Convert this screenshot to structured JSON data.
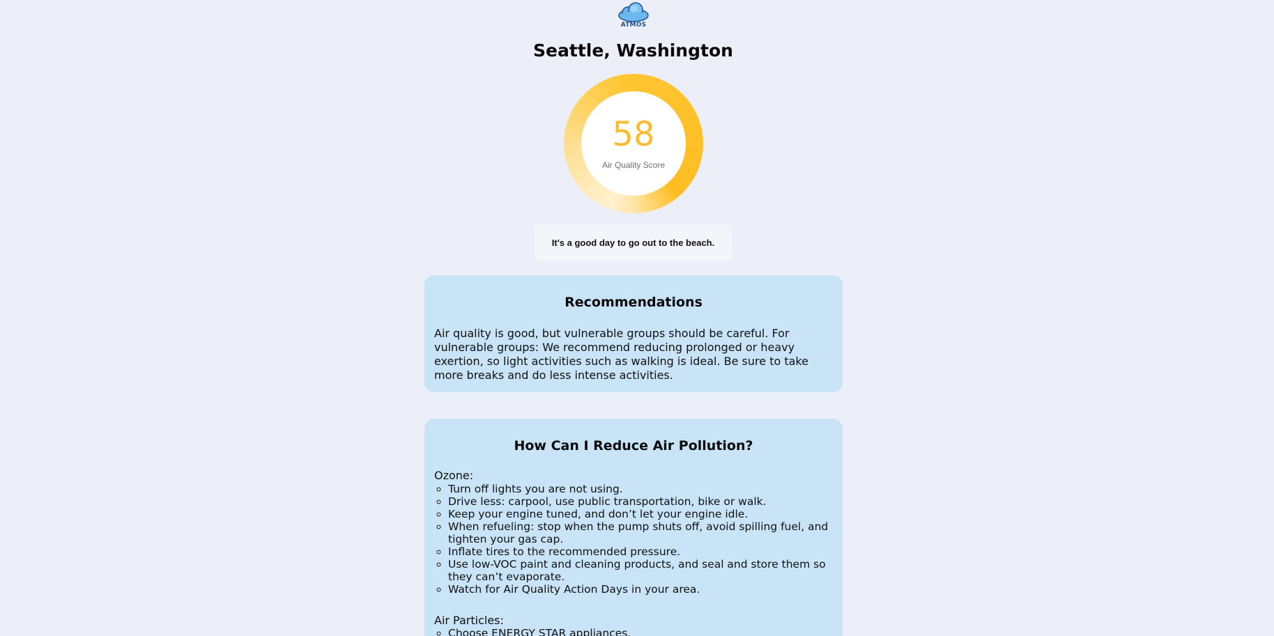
{
  "logo": {
    "text": "ATMOS",
    "icon": "cloud-icon"
  },
  "location": {
    "city": "Seattle, Washington"
  },
  "air_quality": {
    "score": "58",
    "label": "Air Quality Score",
    "color": "#fbbd2e",
    "message": "It's a good day to go out to the beach."
  },
  "recommendations": {
    "title": "Recommendations",
    "text": "Air quality is good, but vulnerable groups should be careful. For vulnerable groups: We recommend reducing prolonged or heavy exertion, so light activities such as walking is ideal. Be sure to take more breaks and do less intense activities."
  },
  "reduce": {
    "title": "How Can I Reduce Air Pollution?",
    "sections": [
      {
        "heading": "Ozone:",
        "items": [
          "Turn off lights you are not using.",
          "Drive less: carpool, use public transportation, bike or walk.",
          "Keep your engine tuned, and don’t let your engine idle.",
          "When refueling: stop when the pump shuts off, avoid spilling fuel, and tighten your gas cap.",
          "Inflate tires to the recommended pressure.",
          "Use low-VOC paint and cleaning products, and seal and store them so they can’t evaporate.",
          "Watch for Air Quality Action Days in your area."
        ]
      },
      {
        "heading": "Air Particles:",
        "items": [
          "Choose ENERGY STAR appliances."
        ]
      }
    ]
  },
  "colors": {
    "background": "#eceef8",
    "card": "#c9e3f7",
    "gauge_accent": "#ffbd22"
  }
}
